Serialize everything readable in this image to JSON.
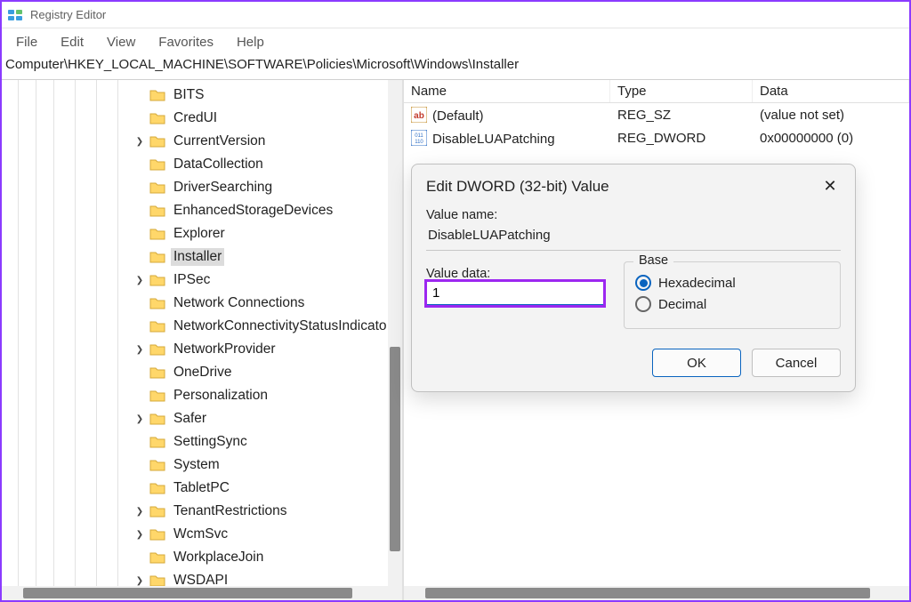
{
  "window": {
    "title": "Registry Editor"
  },
  "menubar": [
    "File",
    "Edit",
    "View",
    "Favorites",
    "Help"
  ],
  "pathbar": "Computer\\HKEY_LOCAL_MACHINE\\SOFTWARE\\Policies\\Microsoft\\Windows\\Installer",
  "tree": [
    {
      "label": "BITS",
      "indent": 148,
      "exp": ""
    },
    {
      "label": "CredUI",
      "indent": 148,
      "exp": ""
    },
    {
      "label": "CurrentVersion",
      "indent": 148,
      "exp": ">"
    },
    {
      "label": "DataCollection",
      "indent": 148,
      "exp": ""
    },
    {
      "label": "DriverSearching",
      "indent": 148,
      "exp": ""
    },
    {
      "label": "EnhancedStorageDevices",
      "indent": 148,
      "exp": ""
    },
    {
      "label": "Explorer",
      "indent": 148,
      "exp": ""
    },
    {
      "label": "Installer",
      "indent": 148,
      "exp": "",
      "selected": true
    },
    {
      "label": "IPSec",
      "indent": 148,
      "exp": ">"
    },
    {
      "label": "Network Connections",
      "indent": 148,
      "exp": ""
    },
    {
      "label": "NetworkConnectivityStatusIndicato",
      "indent": 148,
      "exp": ""
    },
    {
      "label": "NetworkProvider",
      "indent": 148,
      "exp": ">"
    },
    {
      "label": "OneDrive",
      "indent": 148,
      "exp": ""
    },
    {
      "label": "Personalization",
      "indent": 148,
      "exp": ""
    },
    {
      "label": "Safer",
      "indent": 148,
      "exp": ">"
    },
    {
      "label": "SettingSync",
      "indent": 148,
      "exp": ""
    },
    {
      "label": "System",
      "indent": 148,
      "exp": ""
    },
    {
      "label": "TabletPC",
      "indent": 148,
      "exp": ""
    },
    {
      "label": "TenantRestrictions",
      "indent": 148,
      "exp": ">"
    },
    {
      "label": "WcmSvc",
      "indent": 148,
      "exp": ">"
    },
    {
      "label": "WorkplaceJoin",
      "indent": 148,
      "exp": ""
    },
    {
      "label": "WSDAPI",
      "indent": 148,
      "exp": ">"
    }
  ],
  "list": {
    "cols": [
      "Name",
      "Type",
      "Data"
    ],
    "rows": [
      {
        "name": "(Default)",
        "type": "REG_SZ",
        "data": "(value not set)",
        "icon": "ab"
      },
      {
        "name": "DisableLUAPatching",
        "type": "REG_DWORD",
        "data": "0x00000000 (0)",
        "icon": "bin"
      }
    ]
  },
  "dialog": {
    "title": "Edit DWORD (32-bit) Value",
    "name_label": "Value name:",
    "value_name": "DisableLUAPatching",
    "data_label": "Value data:",
    "value_data": "1",
    "base_label": "Base",
    "radio_hex": "Hexadecimal",
    "radio_dec": "Decimal",
    "ok": "OK",
    "cancel": "Cancel"
  },
  "colors": {
    "accent": "#9c27f0"
  }
}
